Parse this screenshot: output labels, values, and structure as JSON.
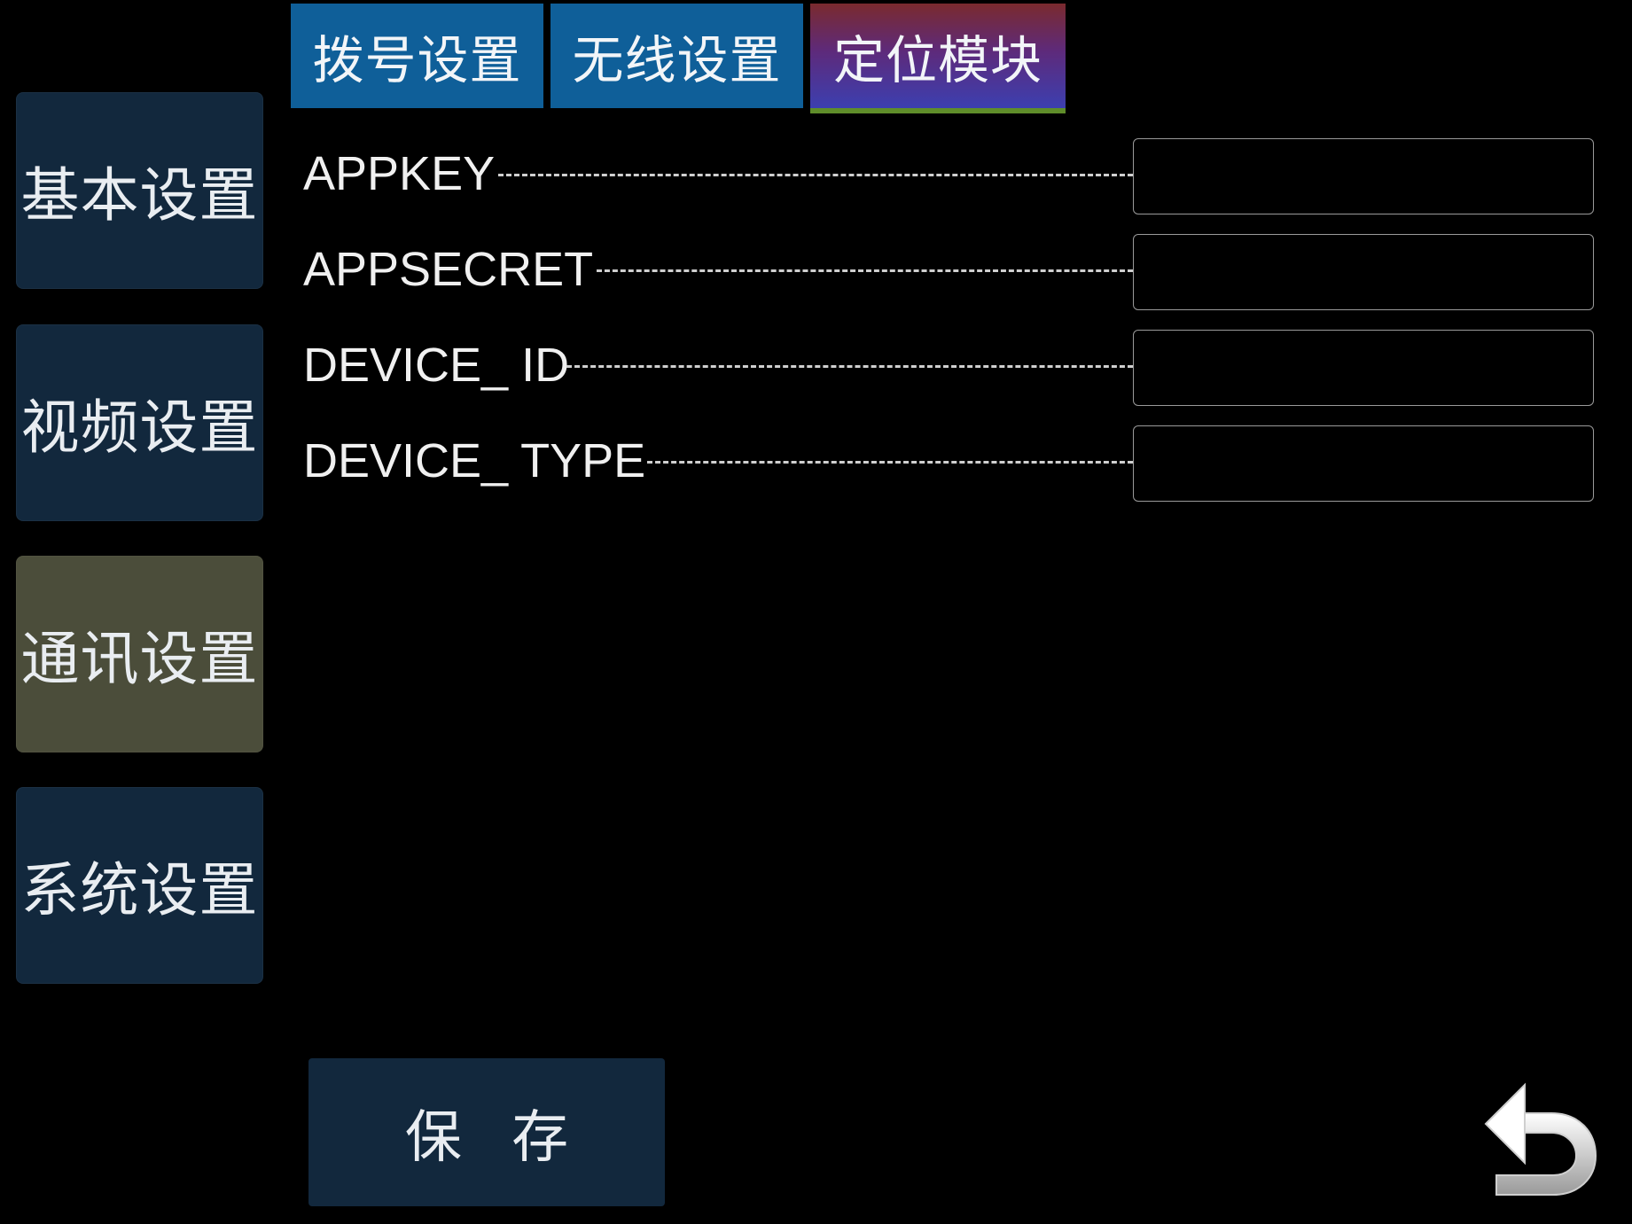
{
  "sidebar": {
    "items": [
      {
        "label": "基本设置",
        "active": false
      },
      {
        "label": "视频设置",
        "active": false
      },
      {
        "label": "通讯设置",
        "active": true
      },
      {
        "label": "系统设置",
        "active": false
      }
    ]
  },
  "tabs": [
    {
      "label": "拨号设置",
      "active": false
    },
    {
      "label": "无线设置",
      "active": false
    },
    {
      "label": "定位模块",
      "active": true
    }
  ],
  "form": {
    "fields": [
      {
        "label": "APPKEY",
        "value": ""
      },
      {
        "label": "APPSECRET",
        "value": ""
      },
      {
        "label": "DEVICE_ ID",
        "value": ""
      },
      {
        "label": "DEVICE_ TYPE",
        "value": ""
      }
    ]
  },
  "actions": {
    "save_label": "保 存",
    "back_icon": "back-arrow-icon"
  },
  "colors": {
    "background": "#000000",
    "sidebar_button": "#12283d",
    "sidebar_active": "#4b4d3a",
    "tab": "#0f5f99",
    "tab_active_underline": "#5f8d2a"
  }
}
